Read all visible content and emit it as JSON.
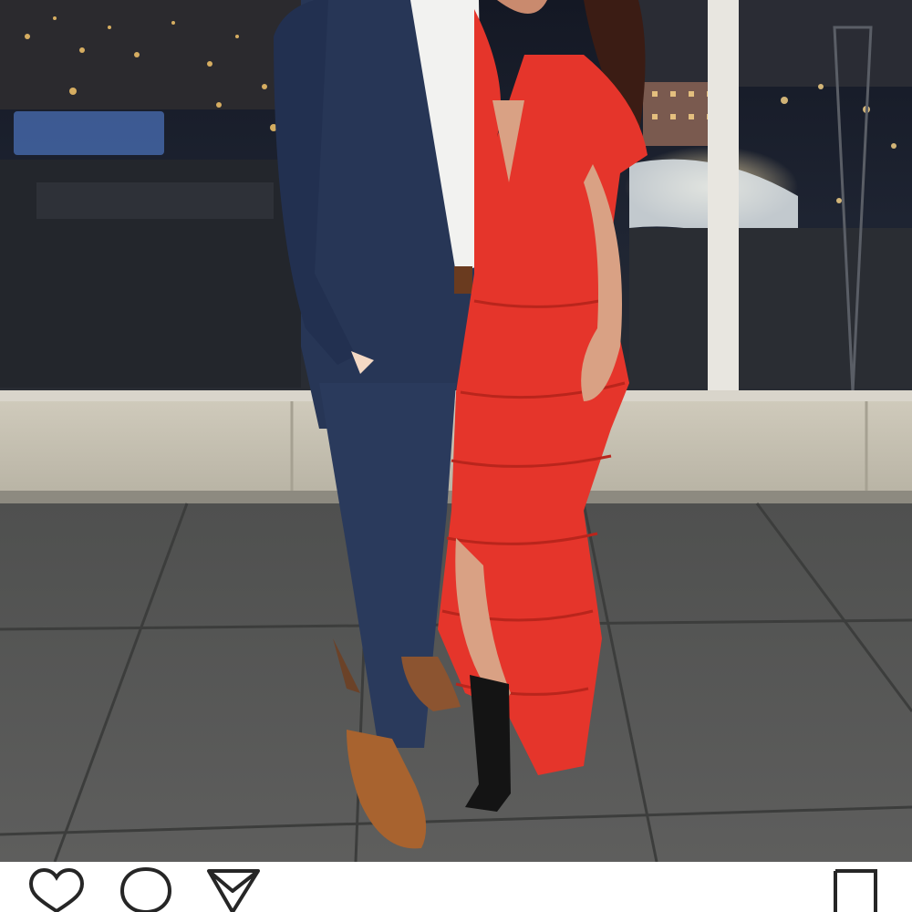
{
  "post": {
    "photo": {
      "subject": "couple-on-rooftop-at-night",
      "colors": {
        "dress": "#e5352b",
        "suit": "#273656",
        "floor": "#5b5b5a",
        "night_sky": "#1c2230"
      }
    },
    "actions": {
      "icons": [
        "heart-icon",
        "comment-icon",
        "share-icon",
        "bookmark-icon"
      ],
      "icon_color": "#262626"
    }
  }
}
